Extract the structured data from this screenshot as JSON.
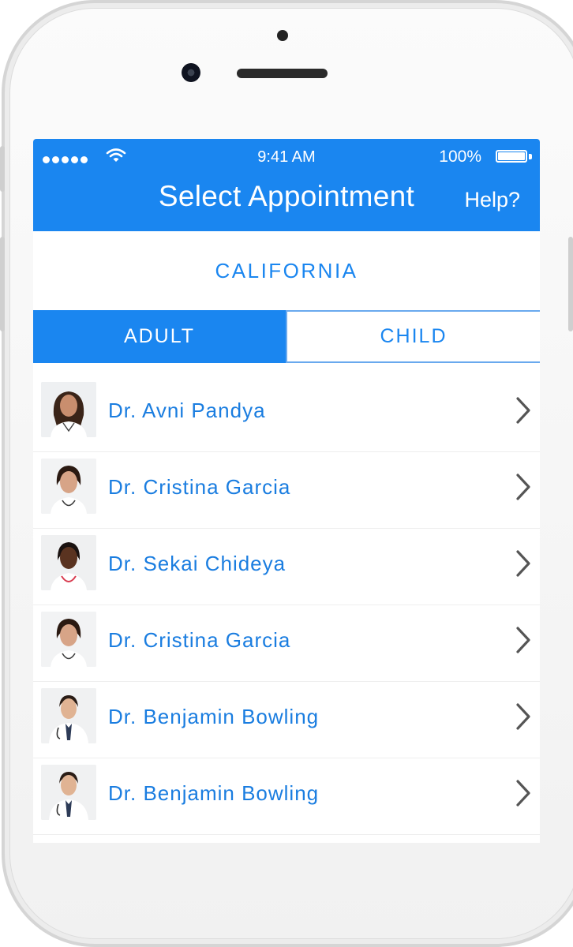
{
  "status_bar": {
    "time": "9:41 AM",
    "battery": "100%"
  },
  "header": {
    "title": "Select Appointment",
    "help": "Help?"
  },
  "region": {
    "label": "CALIFORNIA"
  },
  "tabs": [
    {
      "label": "ADULT",
      "active": true
    },
    {
      "label": "CHILD",
      "active": false
    }
  ],
  "doctors": [
    {
      "name": "Dr. Avni Pandya",
      "avatar": "female-doctor-photo"
    },
    {
      "name": "Dr. Cristina Garcia",
      "avatar": "female-doctor-photo"
    },
    {
      "name": "Dr. Sekai Chideya",
      "avatar": "female-doctor-photo"
    },
    {
      "name": "Dr. Cristina Garcia",
      "avatar": "female-doctor-photo"
    },
    {
      "name": "Dr. Benjamin Bowling",
      "avatar": "male-doctor-photo"
    },
    {
      "name": "Dr. Benjamin Bowling",
      "avatar": "male-doctor-photo"
    }
  ],
  "colors": {
    "accent": "#1a86f0",
    "text_blue": "#1a7de0",
    "chevron": "#555555"
  },
  "icons": {
    "row_action": "chevron-right-icon"
  }
}
